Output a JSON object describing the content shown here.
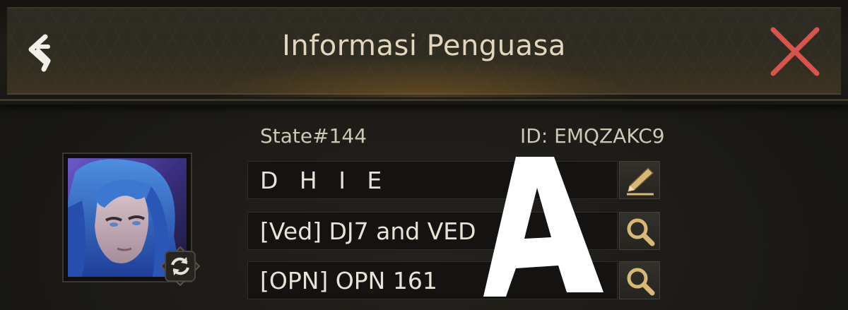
{
  "header": {
    "title": "Informasi Penguasa"
  },
  "profile": {
    "state": "State#144",
    "id": "ID: EMQZAKC9",
    "name": "D H I E",
    "alliance": "[Ved] DJ7 and VED",
    "organization": "[OPN] OPN 161"
  },
  "icons": {
    "back": "back-arrow-icon",
    "close": "close-x-icon",
    "edit": "pencil-icon",
    "search": "magnifier-icon",
    "swap": "swap-arrows-icon"
  },
  "watermark": {
    "text": "A"
  },
  "colors": {
    "title": "#e2d6bd",
    "close": "#d9544c",
    "icon_gold": "#d8b874",
    "text": "#e8e3d8"
  }
}
